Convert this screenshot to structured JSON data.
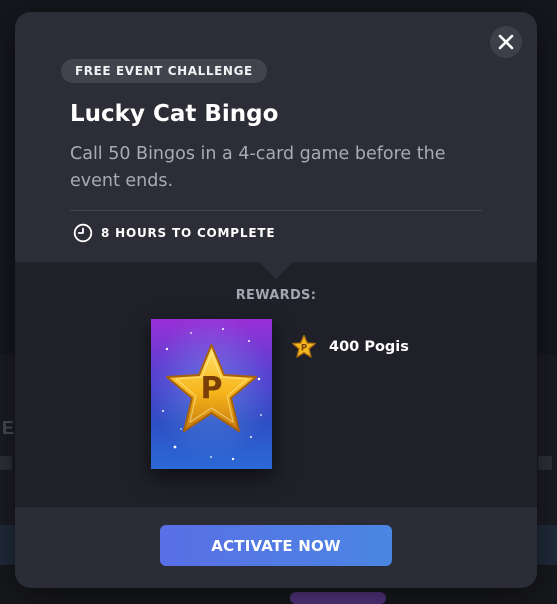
{
  "modal": {
    "badge": "FREE EVENT CHALLENGE",
    "title": "Lucky Cat Bingo",
    "description": "Call 50 Bingos in a 4-card game before the event ends.",
    "duration": "8 HOURS TO COMPLETE",
    "rewards_label": "REWARDS:",
    "rewards": [
      {
        "icon": "pogi-star-icon",
        "label": "400 Pogis"
      }
    ],
    "card_letter": "P",
    "activate_label": "ACTIVATE NOW",
    "close_icon": "close-icon"
  },
  "colors": {
    "modal_bg": "#2c2d36",
    "accent_button": "#5a6fe6",
    "badge_bg": "#41434d"
  }
}
